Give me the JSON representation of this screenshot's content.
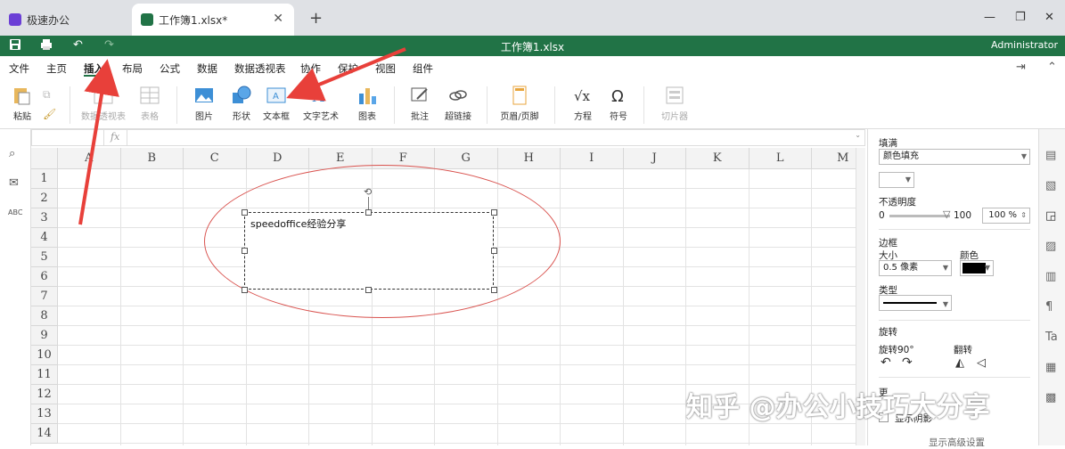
{
  "browser": {
    "tabs": [
      {
        "label": "极速办公",
        "active": false
      },
      {
        "label": "工作簿1.xlsx*",
        "active": true
      }
    ],
    "new_tab": "+",
    "win_min": "—",
    "win_max": "❐",
    "win_close": "✕"
  },
  "titlebar": {
    "doc_title": "工作簿1.xlsx",
    "user": "Administrator",
    "color": "#217346"
  },
  "menu": [
    "文件",
    "主页",
    "插入",
    "布局",
    "公式",
    "数据",
    "数据透视表",
    "协作",
    "保护",
    "视图",
    "组件"
  ],
  "menu_active": "插入",
  "ribbon": {
    "paste": "粘贴",
    "pivot": "数据透视表",
    "table": "表格",
    "picture": "图片",
    "shape": "形状",
    "textbox": "文本框",
    "wordart": "文字艺术",
    "chart": "图表",
    "comment": "批注",
    "hyperlink": "超链接",
    "headerfooter": "页眉/页脚",
    "equation": "方程",
    "symbol": "符号",
    "slicer": "切片器"
  },
  "formula_bar": {
    "fx": "fx"
  },
  "grid": {
    "columns": [
      "A",
      "B",
      "C",
      "D",
      "E",
      "F",
      "G",
      "H",
      "I",
      "J",
      "K",
      "L",
      "M"
    ],
    "rows": [
      "1",
      "2",
      "3",
      "4",
      "5",
      "6",
      "7",
      "8",
      "9",
      "10",
      "11",
      "12",
      "13",
      "14"
    ]
  },
  "textbox": {
    "text": "speedoffice经验分享"
  },
  "panel": {
    "fill_title": "填满",
    "fill_type": "颜色填充",
    "opacity_title": "不透明度",
    "opacity_min": "0",
    "opacity_max": "100",
    "opacity_value": "100 %",
    "border_title": "边框",
    "size_label": "大小",
    "color_label": "颜色",
    "size_value": "0.5 像素",
    "type_label": "类型",
    "rotate_title": "旋转",
    "rotate90": "旋转90°",
    "flip": "翻转",
    "more_label": "更",
    "shadow_label": "显示阴影",
    "advanced_label": "显示高级设置"
  },
  "watermark": "知乎 @办公小技巧大分享"
}
